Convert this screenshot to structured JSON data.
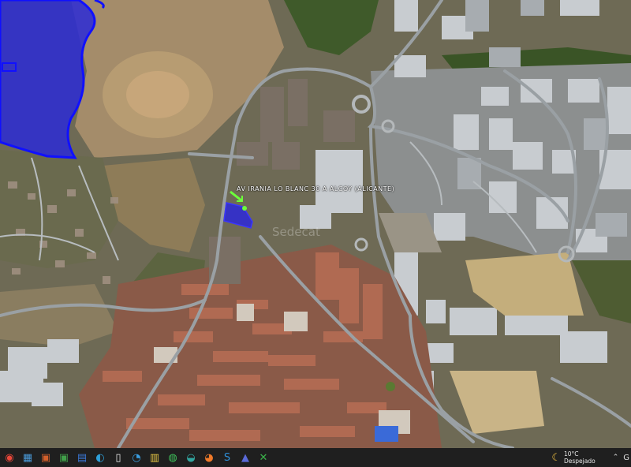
{
  "map": {
    "parcel_label": "AV IRANIA LO BLANC 30 A ALCOY (ALICANTE)",
    "watermark": "Sedecat",
    "colors": {
      "flood_zone": "#2b2ad6",
      "flood_zone_border": "#1010ff",
      "parcel": "#2d28d9",
      "road": "#9aa0a4",
      "vegetation": "#49632f",
      "dry_hill": "#a48c6a",
      "city_block": "#b06a52",
      "industrial": "#c8ccd0",
      "marker": "#6cff3a"
    }
  },
  "taskbar": {
    "weather": {
      "temperature": "10°C",
      "condition": "Despejado",
      "icon": "moon-icon"
    },
    "apps": [
      {
        "name": "chrome-app-icon",
        "glyph": "◉",
        "color": "#e9473a"
      },
      {
        "name": "app-2-icon",
        "glyph": "▦",
        "color": "#4a9ad9"
      },
      {
        "name": "slides-app-icon",
        "glyph": "▣",
        "color": "#d35f2b"
      },
      {
        "name": "app-4-icon",
        "glyph": "▣",
        "color": "#41a04a"
      },
      {
        "name": "store-app-icon",
        "glyph": "▤",
        "color": "#3b78d8"
      },
      {
        "name": "edge-app-icon",
        "glyph": "◐",
        "color": "#2ea0d9"
      },
      {
        "name": "file-app-icon",
        "glyph": "▯",
        "color": "#e6e6e6"
      },
      {
        "name": "photos-app-icon",
        "glyph": "◔",
        "color": "#3a9ee0"
      },
      {
        "name": "documents-app-icon",
        "glyph": "▥",
        "color": "#e5c545"
      },
      {
        "name": "whatsapp-app-icon",
        "glyph": "◍",
        "color": "#3fc15b"
      },
      {
        "name": "app-11-icon",
        "glyph": "◒",
        "color": "#32a6a0"
      },
      {
        "name": "firefox-app-icon",
        "glyph": "◕",
        "color": "#f07a2a"
      },
      {
        "name": "app-13-icon",
        "glyph": "S",
        "color": "#2f8fd8"
      },
      {
        "name": "app-14-icon",
        "glyph": "▲",
        "color": "#5a6ad8"
      },
      {
        "name": "app-15-icon",
        "glyph": "✕",
        "color": "#3bb24a"
      }
    ]
  }
}
